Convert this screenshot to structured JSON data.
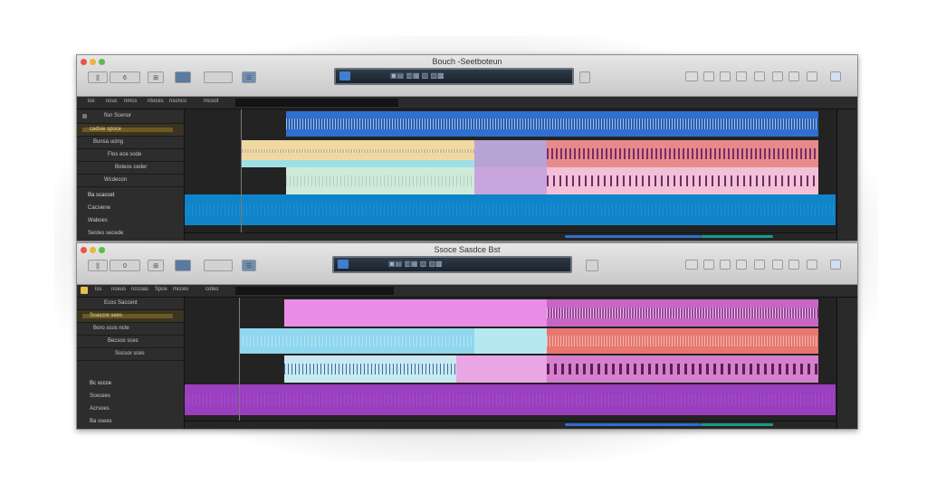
{
  "windows": [
    {
      "title": "Bouch -Seetboteun",
      "toolbar": {
        "b1": "||",
        "b2": "6",
        "b3": "⊞",
        "b4": "☰"
      },
      "lcd_text": "▣▤ ▥▦ ▧ ▨▩",
      "control_bar": [
        "ios",
        "ncuc",
        "nmcs",
        "ntoces",
        "nsoncs",
        "mcoot"
      ],
      "tracks": [
        {
          "label": "fisn Scenor"
        },
        {
          "label": "cadsie spoce"
        },
        {
          "label": "Bunsa ucing"
        },
        {
          "label": "Flos ece sode"
        },
        {
          "label": "Boteos ceder"
        },
        {
          "label": "Wcdecon"
        },
        {
          "label": "Ba scaccet"
        },
        {
          "label": "Cacsiene"
        },
        {
          "label": "Waboes"
        },
        {
          "label": "Sestes secede"
        }
      ],
      "accent": "#2f7dd1"
    },
    {
      "title": "Ssoce Sasdce Bst",
      "toolbar": {
        "b1": "||",
        "b2": "0",
        "b3": "⊞",
        "b4": "☰"
      },
      "lcd_text": "▣▤ ▥▦ ▧ ▨▩",
      "control_bar": [
        "iss",
        "nceus",
        "nccoas",
        "Spce",
        "mcces",
        "cotes"
      ],
      "tracks": [
        {
          "label": "Ecos Saccent"
        },
        {
          "label": "Scascre sees"
        },
        {
          "label": "Boro scos ncte"
        },
        {
          "label": "Becsos sces"
        },
        {
          "label": "Socsor sces"
        },
        {
          "label": "Bc sccce"
        },
        {
          "label": "Scecees"
        },
        {
          "label": "Acrsoes"
        },
        {
          "label": "Ba ssees"
        }
      ],
      "accent": "#a545c9"
    }
  ]
}
